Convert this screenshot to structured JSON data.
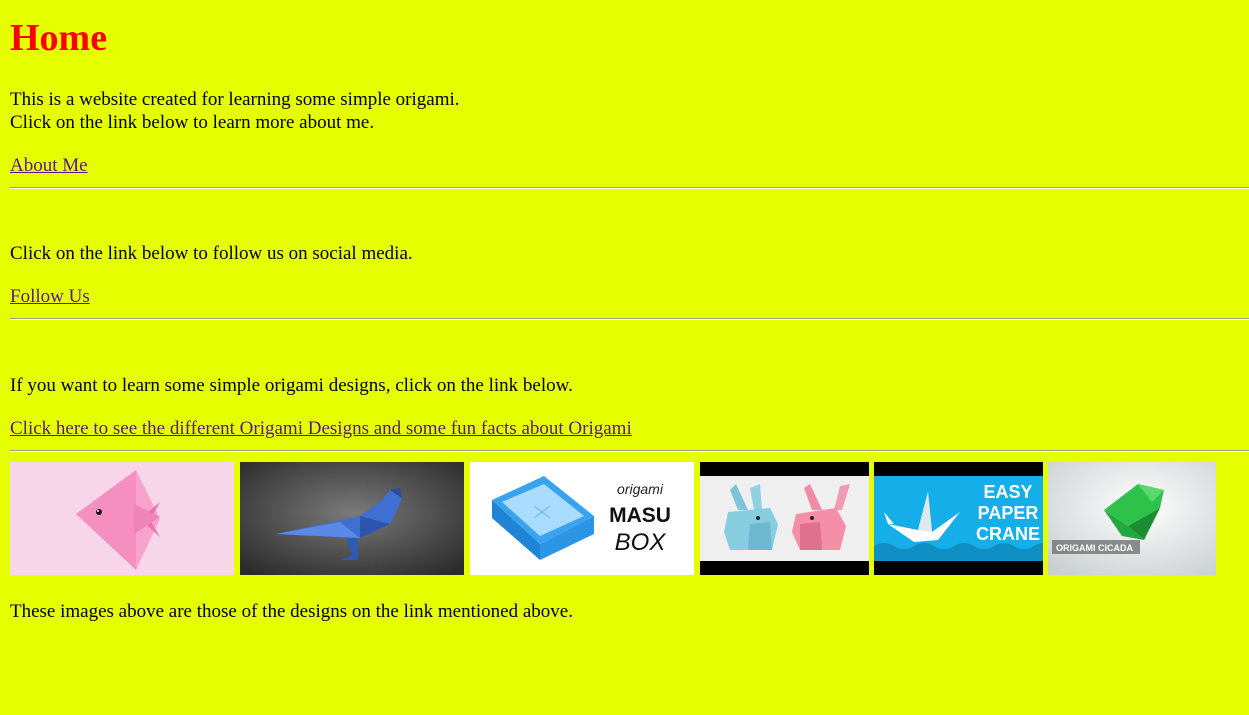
{
  "page": {
    "title": "Home",
    "intro_line1": "This is a website created for learning some simple origami.",
    "intro_line2": "Click on the link below to learn more about me.",
    "about_link": "About Me",
    "social_text": "Click on the link below to follow us on social media.",
    "follow_link": "Follow Us",
    "designs_text": "If you want to learn some simple origami designs, click on the link below.",
    "designs_link": "Click here to see the different Origami Designs and some fun facts about Origami",
    "footer_text": "These images above are those of the designs on the link mentioned above."
  },
  "images": {
    "masu_line1": "origami",
    "masu_line2": "MASU",
    "masu_line3": "BOX",
    "crane_line1": "EASY",
    "crane_line2": "PAPER",
    "crane_line3": "CRANE",
    "cicada_label": "ORIGAMI CICADA"
  },
  "colors": {
    "background": "#e6ff00",
    "title": "#ff0000",
    "link": "#551a8b"
  }
}
